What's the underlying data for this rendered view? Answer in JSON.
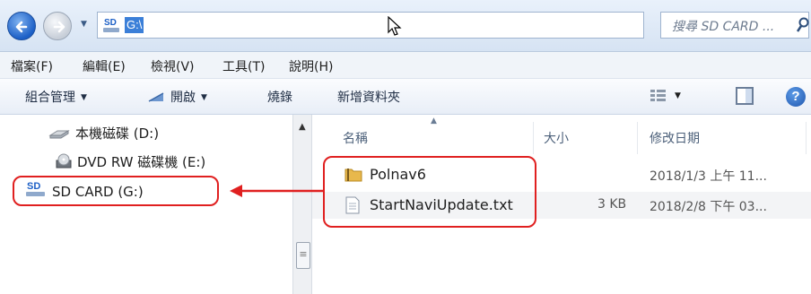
{
  "address_bar": {
    "drive_icon_label": "SD",
    "path": "G:\\",
    "search_placeholder": "搜尋 SD CARD ..."
  },
  "menu": [
    "檔案(F)",
    "編輯(E)",
    "檢視(V)",
    "工具(T)",
    "說明(H)"
  ],
  "toolbar": {
    "organize": "組合管理",
    "open": "開啟",
    "burn": "燒錄",
    "new_folder": "新增資料夾"
  },
  "nav_pane": {
    "items": [
      {
        "label": "本機磁碟 (D:)",
        "icon": "local-disk-icon"
      },
      {
        "label": "DVD RW 磁碟機 (E:)",
        "icon": "dvd-drive-icon"
      },
      {
        "label": "SD CARD (G:)",
        "icon": "sd-card-icon",
        "icon_text": "SD"
      }
    ]
  },
  "columns": {
    "name": "名稱",
    "size": "大小",
    "date": "修改日期"
  },
  "files": [
    {
      "name": "Polnav6",
      "type": "folder",
      "size": "",
      "date": "2018/1/3 上午 11..."
    },
    {
      "name": "StartNaviUpdate.txt",
      "type": "text-file",
      "size": "3 KB",
      "date": "2018/2/8 下午 03..."
    }
  ],
  "annotation_color": "#e02020",
  "accent_color": "#3b7fd8"
}
